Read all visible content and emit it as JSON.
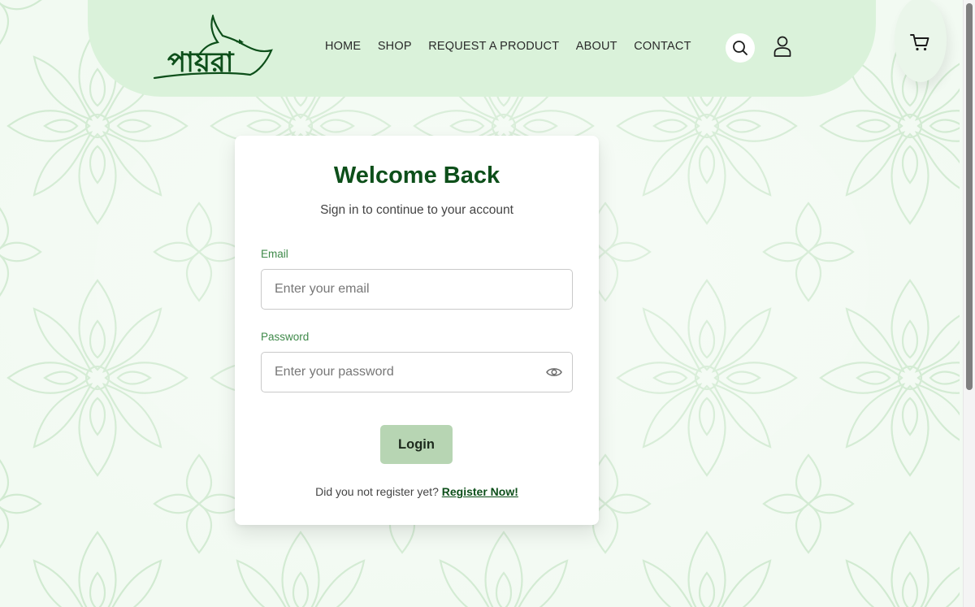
{
  "brand": {
    "logo_text": "পায়রা"
  },
  "nav": {
    "items": [
      "HOME",
      "SHOP",
      "REQUEST A PRODUCT",
      "ABOUT",
      "CONTACT"
    ]
  },
  "icons": {
    "search": "search-icon",
    "user": "user-icon",
    "cart": "cart-icon",
    "eye": "eye-icon"
  },
  "login": {
    "title": "Welcome Back",
    "subtitle": "Sign in to continue to your account",
    "email_label": "Email",
    "email_placeholder": "Enter your email",
    "password_label": "Password",
    "password_placeholder": "Enter your password",
    "button": "Login",
    "register_prompt": "Did you not register yet?",
    "register_link": "Register Now!"
  },
  "colors": {
    "brand_green": "#0d4f1a",
    "header_bg": "#daf2da",
    "button_bg": "#b7d5b3",
    "label_green": "#3f8a4a"
  }
}
